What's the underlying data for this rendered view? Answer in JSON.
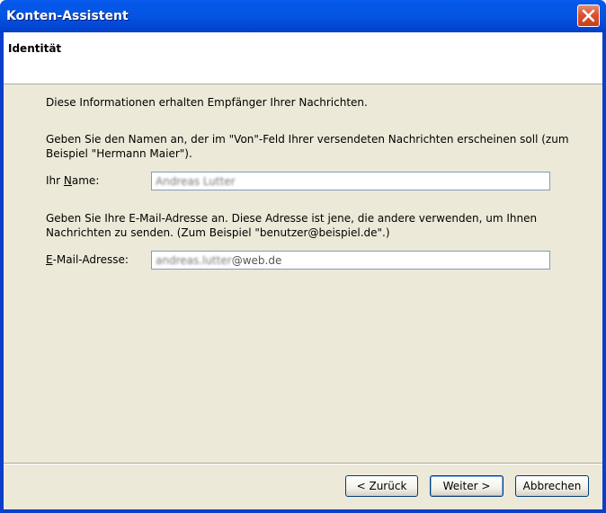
{
  "window": {
    "title": "Konten-Assistent"
  },
  "page": {
    "title": "Identität",
    "intro": "Diese Informationen erhalten Empfänger Ihrer Nachrichten.",
    "name_help_line1": "Geben Sie den Namen an, der im \"Von\"-Feld Ihrer versendeten Nachrichten erscheinen soll (zum",
    "name_help_line2": "Beispiel \"Hermann Maier\").",
    "name_label_pre": "Ihr ",
    "name_label_accel": "N",
    "name_label_post": "ame:",
    "name_value": "Andreas Lutter",
    "email_help_line1": "Geben Sie Ihre E-Mail-Adresse an. Diese Adresse ist jene, die andere verwenden, um Ihnen",
    "email_help_line2": "Nachrichten zu senden. (Zum Beispiel \"benutzer@beispiel.de\".)",
    "email_label_accel": "E",
    "email_label_post": "-Mail-Adresse:",
    "email_value_blurred": "andreas.lutter",
    "email_value_domain": "@web.de"
  },
  "buttons": {
    "back": "< Zurück",
    "next": "Weiter >",
    "cancel": "Abbrechen"
  },
  "icons": {
    "close": "close-icon"
  },
  "colors": {
    "titlebar": "#0458e9",
    "close": "#d8532f",
    "client": "#ece9d8"
  }
}
